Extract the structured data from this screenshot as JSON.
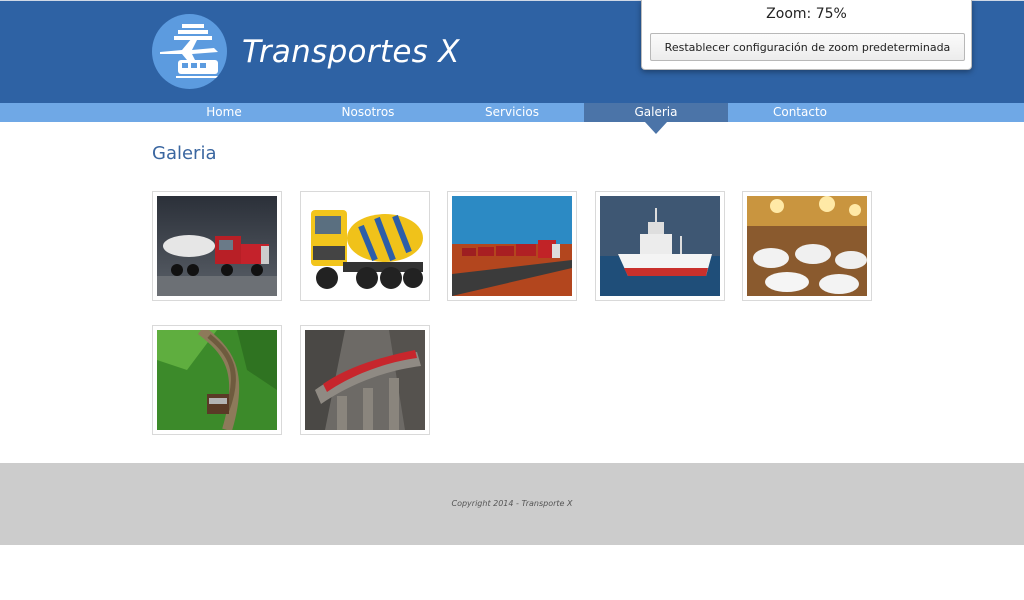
{
  "header": {
    "site_title": "Transportes X",
    "logo_icon": "plane-ship-train-logo-icon",
    "background": "#2e62a4"
  },
  "zoom_popup": {
    "label": "Zoom: 75%",
    "reset_button": "Restablecer configuración de zoom predeterminada"
  },
  "nav": {
    "items": [
      {
        "label": "Home"
      },
      {
        "label": "Nosotros"
      },
      {
        "label": "Servicios"
      },
      {
        "label": "Galeria",
        "active": true
      },
      {
        "label": "Contacto"
      }
    ],
    "color": "#6fa8e6",
    "active_color": "#4b74a8"
  },
  "main": {
    "title": "Galeria",
    "gallery": [
      {
        "subject": "tanker-truck"
      },
      {
        "subject": "cement-mixer-truck"
      },
      {
        "subject": "road-train"
      },
      {
        "subject": "fishing-ship"
      },
      {
        "subject": "cruise-dining-room"
      },
      {
        "subject": "train-in-forest"
      },
      {
        "subject": "train-on-viaduct"
      }
    ]
  },
  "footer": {
    "copyright": "Copyright 2014 - Transporte X",
    "background": "#cccccc"
  }
}
